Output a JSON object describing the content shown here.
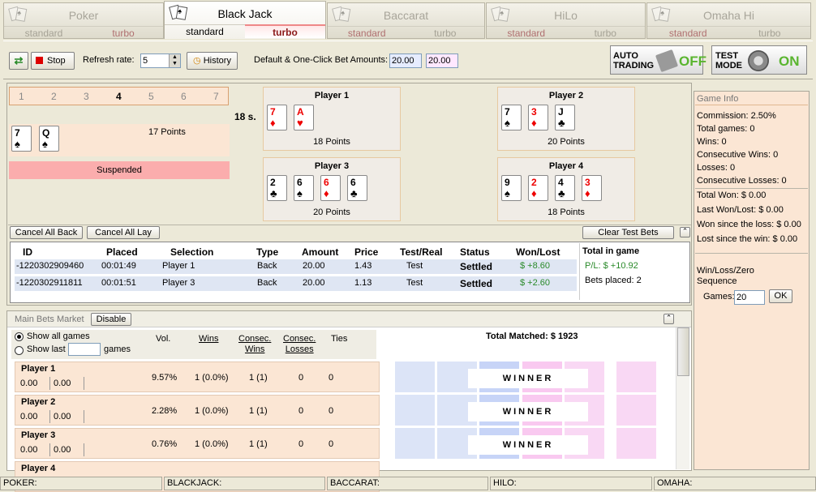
{
  "tabs": [
    {
      "name": "Poker",
      "left": "standard",
      "right": "turbo"
    },
    {
      "name": "Black Jack",
      "left": "standard",
      "right": "turbo"
    },
    {
      "name": "Baccarat",
      "left": "standard",
      "right": "turbo"
    },
    {
      "name": "HiLo",
      "left": "standard",
      "right": "turbo"
    },
    {
      "name": "Omaha Hi",
      "left": "standard",
      "right": "turbo"
    }
  ],
  "toolbar": {
    "stop": "Stop",
    "refresh_label": "Refresh rate:",
    "refresh_value": "5",
    "history": "History",
    "bet_label": "Default & One-Click Bet Amounts:",
    "bet1": "20.00",
    "bet2": "20.00",
    "auto1": "AUTO",
    "auto2": "TRADING",
    "auto_state": "OFF",
    "test1": "TEST",
    "test2": "MODE",
    "test_state": "ON"
  },
  "dealer": {
    "rounds": [
      "1",
      "2",
      "3",
      "4",
      "5",
      "6",
      "7"
    ],
    "cards": [
      {
        "r": "7",
        "s": "♠"
      },
      {
        "r": "Q",
        "s": "♠"
      }
    ],
    "points": "17 Points",
    "status": "Suspended",
    "timer": "18 s."
  },
  "players": [
    {
      "name": "Player 1",
      "points": "18 Points",
      "cards": [
        {
          "r": "7",
          "s": "♦",
          "red": true
        },
        {
          "r": "A",
          "s": "♥",
          "red": true
        }
      ]
    },
    {
      "name": "Player 2",
      "points": "20 Points",
      "cards": [
        {
          "r": "7",
          "s": "♠"
        },
        {
          "r": "3",
          "s": "♦",
          "red": true
        },
        {
          "r": "J",
          "s": "♣"
        }
      ]
    },
    {
      "name": "Player 3",
      "points": "20 Points",
      "cards": [
        {
          "r": "2",
          "s": "♣"
        },
        {
          "r": "6",
          "s": "♠"
        },
        {
          "r": "6",
          "s": "♦",
          "red": true
        },
        {
          "r": "6",
          "s": "♣"
        }
      ]
    },
    {
      "name": "Player 4",
      "points": "18 Points",
      "cards": [
        {
          "r": "9",
          "s": "♠"
        },
        {
          "r": "2",
          "s": "♦",
          "red": true
        },
        {
          "r": "4",
          "s": "♣"
        },
        {
          "r": "3",
          "s": "♦",
          "red": true
        }
      ]
    }
  ],
  "bets": {
    "cancel_back": "Cancel All Back",
    "cancel_lay": "Cancel All Lay",
    "clear": "Clear Test Bets",
    "headers": [
      "ID",
      "Placed",
      "Selection",
      "Type",
      "Amount",
      "Price",
      "Test/Real",
      "Status",
      "Won/Lost"
    ],
    "rows": [
      [
        "-1220302909460",
        "00:01:49",
        "Player 1",
        "Back",
        "20.00",
        "1.43",
        "Test",
        "Settled",
        "$ +8.60"
      ],
      [
        "-1220302911811",
        "00:01:51",
        "Player 3",
        "Back",
        "20.00",
        "1.13",
        "Test",
        "Settled",
        "$ +2.60"
      ]
    ],
    "total_title": "Total in game",
    "pl": "P/L: $ +10.92",
    "placed": "Bets placed: 2"
  },
  "market": {
    "title": "Main Bets Market",
    "disable": "Disable",
    "show_all": "Show all games",
    "show_last": "Show last",
    "games": "games",
    "cols": [
      "Vol.",
      "Wins",
      "Consec.",
      "Wins",
      "Consec.",
      "Losses",
      "Ties"
    ],
    "total": "Total Matched: $ 1923",
    "winner": "WINNER",
    "rows": [
      {
        "name": "Player 1",
        "back": "0.00",
        "lay": "0.00",
        "vol": "9.57%",
        "wins": "1 (0.0%)",
        "cw": "1 (1)",
        "cl": "0",
        "ties": "0"
      },
      {
        "name": "Player 2",
        "back": "0.00",
        "lay": "0.00",
        "vol": "2.28%",
        "wins": "1 (0.0%)",
        "cw": "1 (1)",
        "cl": "0",
        "ties": "0"
      },
      {
        "name": "Player 3",
        "back": "0.00",
        "lay": "0.00",
        "vol": "0.76%",
        "wins": "1 (0.0%)",
        "cw": "1 (1)",
        "cl": "0",
        "ties": "0"
      },
      {
        "name": "Player 4"
      }
    ]
  },
  "info": {
    "title": "Game Info",
    "stats1": [
      "Commission: 2.50%",
      "Total games: 0",
      "Wins: 0",
      "Consecutive Wins: 0",
      "Losses: 0",
      "Consecutive Losses: 0"
    ],
    "stats2": [
      "Total Won: $ 0.00",
      "Last Won/Lost: $ 0.00",
      "Won since the loss: $ 0.00",
      "Lost since the win: $ 0.00"
    ],
    "seq1": "Win/Loss/Zero",
    "seq2": "Sequence",
    "games_label": "Games:",
    "games_value": "20",
    "ok": "OK"
  },
  "statusbar": [
    "POKER:",
    "BLACKJACK:",
    "BACCARAT:",
    "HILO:",
    "OMAHA:"
  ]
}
